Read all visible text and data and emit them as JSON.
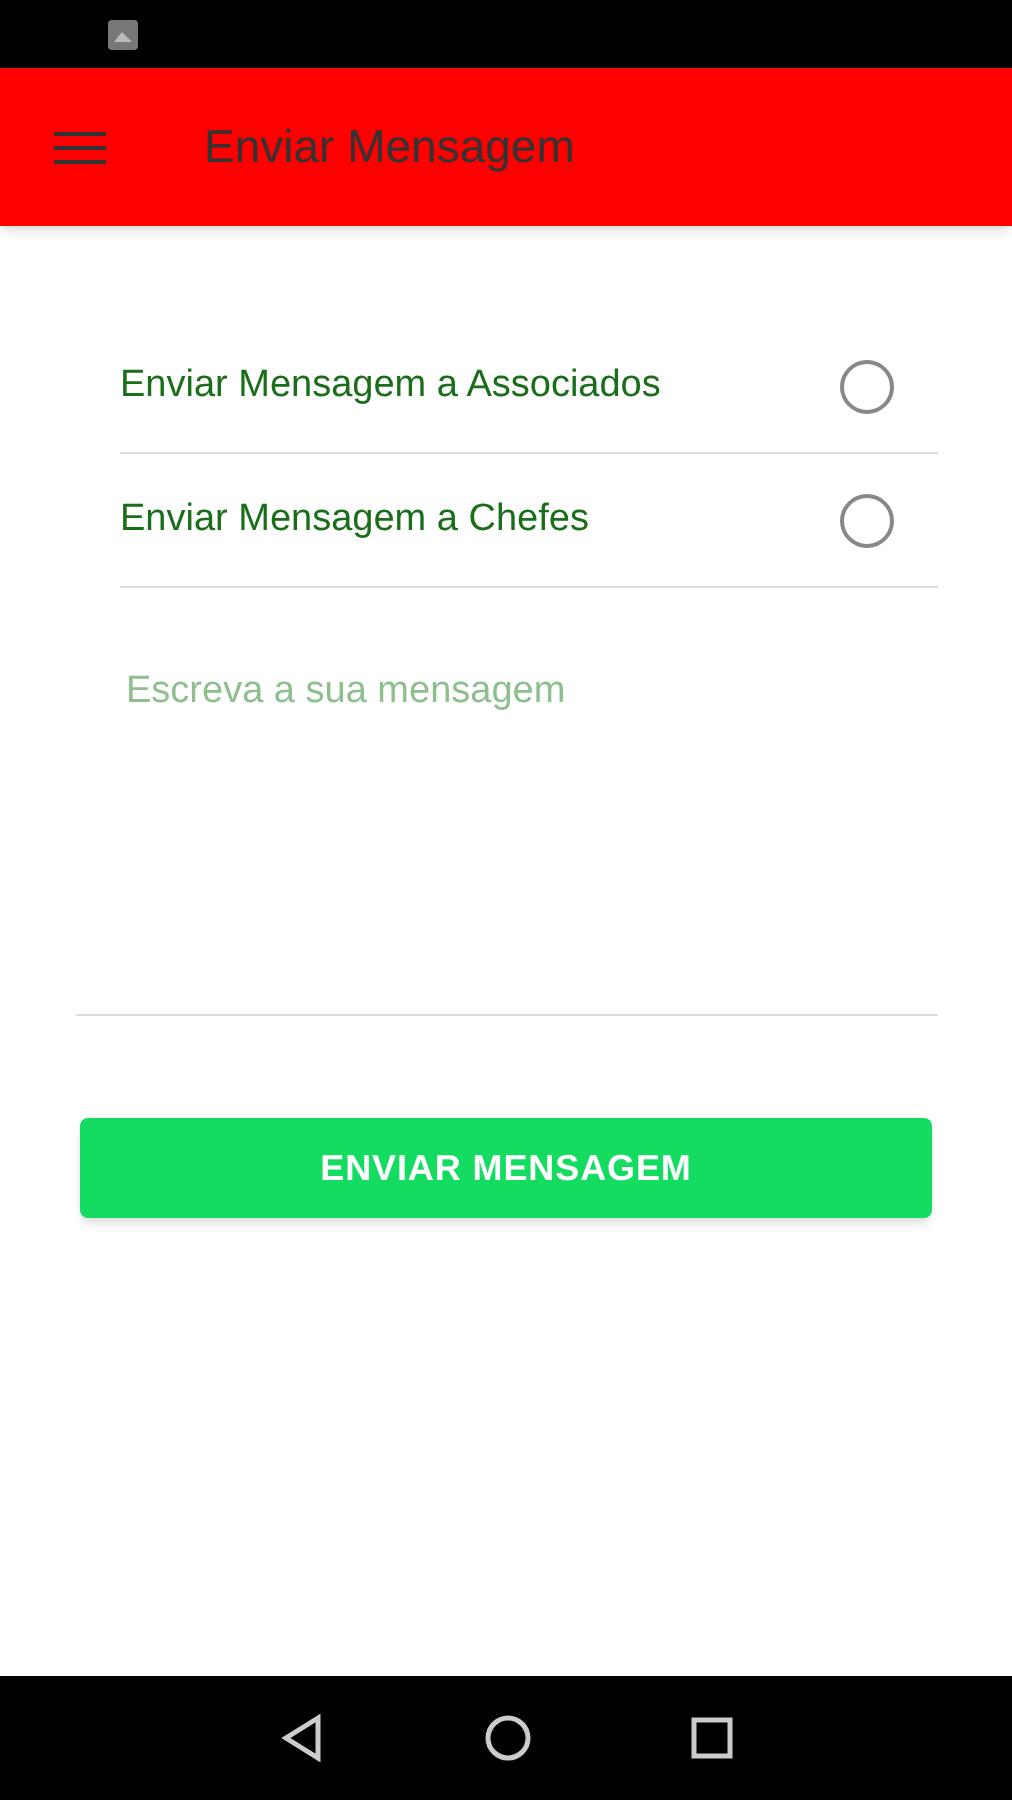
{
  "app_bar": {
    "title": "Enviar Mensagem"
  },
  "options": [
    {
      "label": "Enviar Mensagem a Associados",
      "selected": false
    },
    {
      "label": "Enviar Mensagem a Chefes",
      "selected": false
    }
  ],
  "message": {
    "placeholder": "Escreva a sua mensagem"
  },
  "send_button": {
    "label": "ENVIAR MENSAGEM"
  }
}
